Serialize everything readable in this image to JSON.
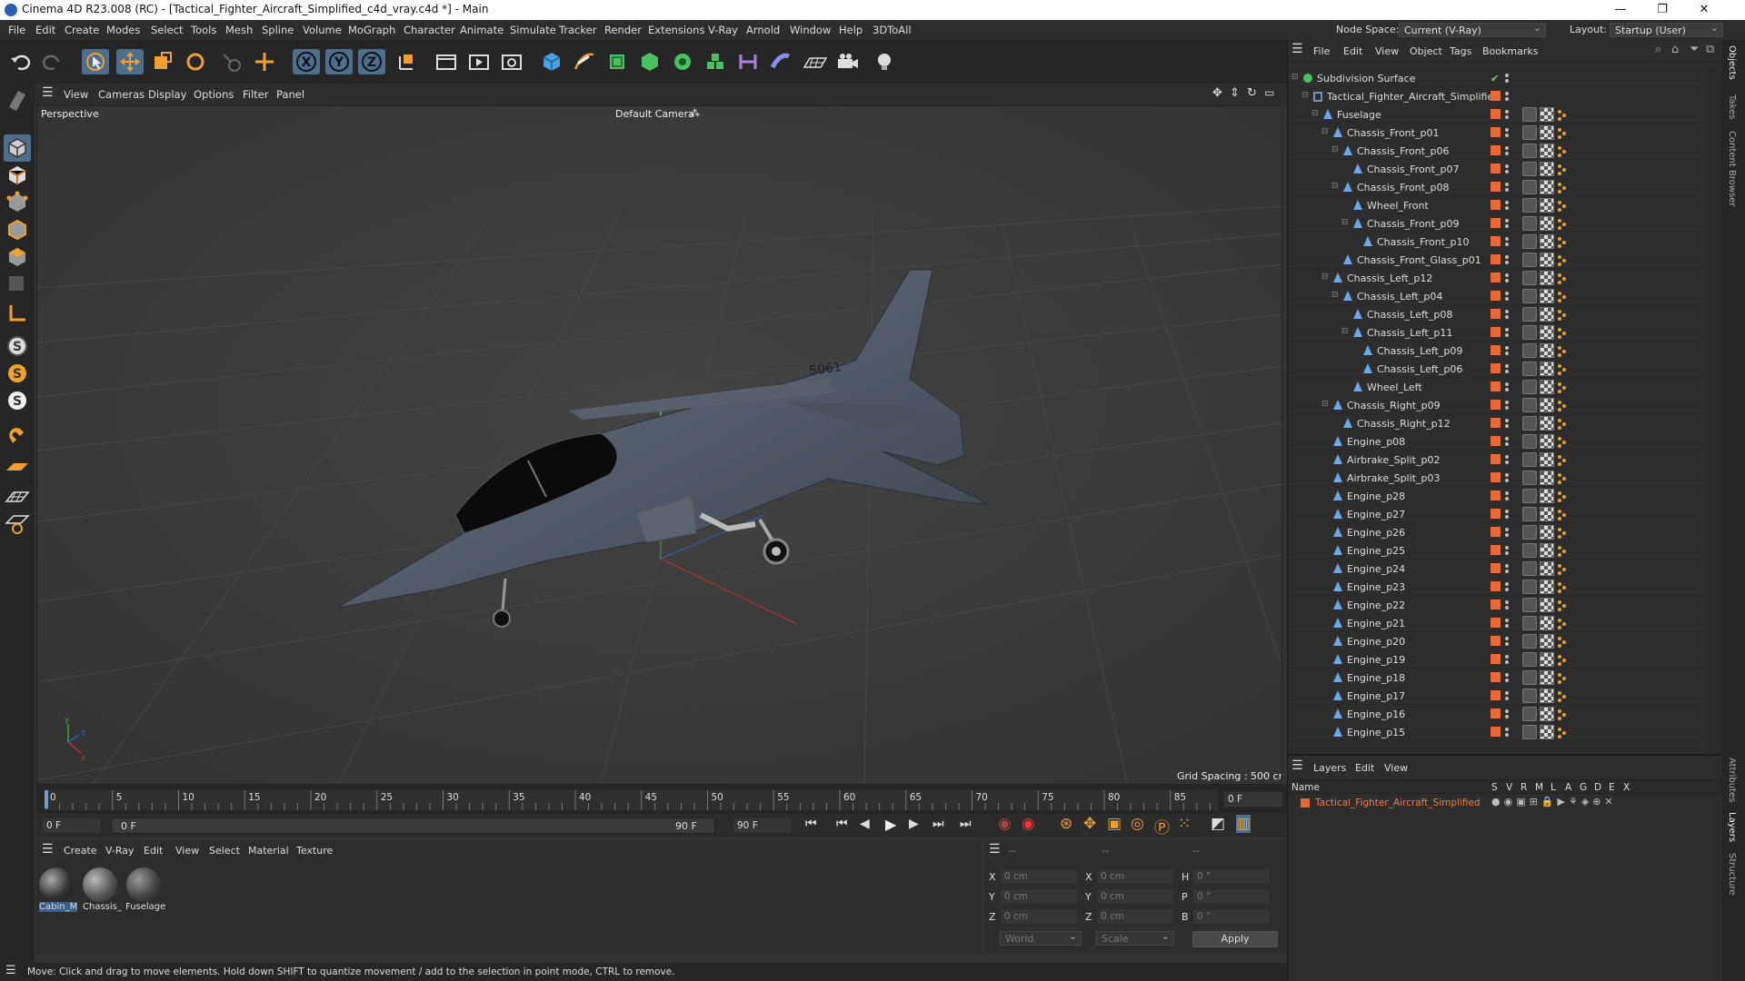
{
  "window": {
    "title": "Cinema 4D R23.008 (RC) - [Tactical_Fighter_Aircraft_Simplified_c4d_vray.c4d *] - Main",
    "minimize": "—",
    "maximize": "❐",
    "close": "✕"
  },
  "menu": [
    "File",
    "Edit",
    "Create",
    "Modes",
    "Select",
    "Tools",
    "Mesh",
    "Spline",
    "Volume",
    "MoGraph",
    "Character",
    "Animate",
    "Simulate",
    "Tracker",
    "Render",
    "Extensions",
    "V-Ray",
    "Arnold",
    "Window",
    "Help",
    "3DToAll"
  ],
  "node_space": {
    "label": "Node Space:",
    "value": "Current (V-Ray)"
  },
  "layout": {
    "label": "Layout:",
    "value": "Startup (User)"
  },
  "viewport": {
    "menu": [
      "View",
      "Cameras",
      "Display",
      "Options",
      "Filter",
      "Panel"
    ],
    "name": "Perspective",
    "camera": "Default Camera",
    "camera_glyph": "⁂",
    "grid_spacing": "Grid Spacing : 500 cm",
    "aircraft_text": "5061"
  },
  "timeline": {
    "ticks": [
      "0",
      "5",
      "10",
      "15",
      "20",
      "25",
      "30",
      "35",
      "40",
      "45",
      "50",
      "55",
      "60",
      "65",
      "70",
      "75",
      "80",
      "85",
      "90"
    ],
    "current_frame": "0 F",
    "start_field": "0 F",
    "range_start": "0 F",
    "range_end": "90 F",
    "end_field": "90 F"
  },
  "material_panel": {
    "menu": [
      "Create",
      "V-Ray",
      "Edit",
      "View",
      "Select",
      "Material",
      "Texture"
    ],
    "materials": [
      "Cabin_M",
      "Chassis_",
      "Fuselage"
    ]
  },
  "attributes": {
    "headers": [
      "--",
      "--",
      "--"
    ],
    "rows": [
      {
        "a": "X",
        "av": "0 cm",
        "b": "X",
        "bv": "0 cm",
        "c": "H",
        "cv": "0 °"
      },
      {
        "a": "Y",
        "av": "0 cm",
        "b": "Y",
        "bv": "0 cm",
        "c": "P",
        "cv": "0 °"
      },
      {
        "a": "Z",
        "av": "0 cm",
        "b": "Z",
        "bv": "0 cm",
        "c": "B",
        "cv": "0 °"
      }
    ],
    "coord_system": "World",
    "mode": "Scale",
    "apply": "Apply"
  },
  "status": "Move: Click and drag to move elements. Hold down SHIFT to quantize movement / add to the selection in point mode, CTRL to remove.",
  "objects_panel": {
    "menu": [
      "File",
      "Edit",
      "View",
      "Object",
      "Tags",
      "Bookmarks"
    ],
    "items": [
      {
        "name": "Subdivision Surface",
        "depth": 0,
        "type": "subdiv"
      },
      {
        "name": "Tactical_Fighter_Aircraft_Simplified",
        "depth": 1,
        "type": "null"
      },
      {
        "name": "Fuselage",
        "depth": 2,
        "type": "poly"
      },
      {
        "name": "Chassis_Front_p01",
        "depth": 3,
        "type": "poly"
      },
      {
        "name": "Chassis_Front_p06",
        "depth": 4,
        "type": "poly"
      },
      {
        "name": "Chassis_Front_p07",
        "depth": 5,
        "type": "poly"
      },
      {
        "name": "Chassis_Front_p08",
        "depth": 4,
        "type": "poly"
      },
      {
        "name": "Wheel_Front",
        "depth": 5,
        "type": "poly"
      },
      {
        "name": "Chassis_Front_p09",
        "depth": 5,
        "type": "poly"
      },
      {
        "name": "Chassis_Front_p10",
        "depth": 6,
        "type": "poly"
      },
      {
        "name": "Chassis_Front_Glass_p01",
        "depth": 4,
        "type": "poly"
      },
      {
        "name": "Chassis_Left_p12",
        "depth": 3,
        "type": "poly"
      },
      {
        "name": "Chassis_Left_p04",
        "depth": 4,
        "type": "poly"
      },
      {
        "name": "Chassis_Left_p08",
        "depth": 5,
        "type": "poly"
      },
      {
        "name": "Chassis_Left_p11",
        "depth": 5,
        "type": "poly"
      },
      {
        "name": "Chassis_Left_p09",
        "depth": 6,
        "type": "poly"
      },
      {
        "name": "Chassis_Left_p06",
        "depth": 6,
        "type": "poly"
      },
      {
        "name": "Wheel_Left",
        "depth": 5,
        "type": "poly"
      },
      {
        "name": "Chassis_Right_p09",
        "depth": 3,
        "type": "poly"
      },
      {
        "name": "Chassis_Right_p12",
        "depth": 4,
        "type": "poly"
      },
      {
        "name": "Engine_p08",
        "depth": 3,
        "type": "poly"
      },
      {
        "name": "Airbrake_Split_p02",
        "depth": 3,
        "type": "poly"
      },
      {
        "name": "Airbrake_Split_p03",
        "depth": 3,
        "type": "poly"
      },
      {
        "name": "Engine_p28",
        "depth": 3,
        "type": "poly"
      },
      {
        "name": "Engine_p27",
        "depth": 3,
        "type": "poly"
      },
      {
        "name": "Engine_p26",
        "depth": 3,
        "type": "poly"
      },
      {
        "name": "Engine_p25",
        "depth": 3,
        "type": "poly"
      },
      {
        "name": "Engine_p24",
        "depth": 3,
        "type": "poly"
      },
      {
        "name": "Engine_p23",
        "depth": 3,
        "type": "poly"
      },
      {
        "name": "Engine_p22",
        "depth": 3,
        "type": "poly"
      },
      {
        "name": "Engine_p21",
        "depth": 3,
        "type": "poly"
      },
      {
        "name": "Engine_p20",
        "depth": 3,
        "type": "poly"
      },
      {
        "name": "Engine_p19",
        "depth": 3,
        "type": "poly"
      },
      {
        "name": "Engine_p18",
        "depth": 3,
        "type": "poly"
      },
      {
        "name": "Engine_p17",
        "depth": 3,
        "type": "poly"
      },
      {
        "name": "Engine_p16",
        "depth": 3,
        "type": "poly"
      },
      {
        "name": "Engine_p15",
        "depth": 3,
        "type": "poly"
      }
    ]
  },
  "layers_panel": {
    "menu": [
      "Layers",
      "Edit",
      "View"
    ],
    "name_header": "Name",
    "columns": [
      "S",
      "V",
      "R",
      "M",
      "L",
      "A",
      "G",
      "D",
      "E",
      "X"
    ],
    "layer": {
      "name": "Tactical_Fighter_Aircraft_Simplified",
      "color": "#e66a3a"
    }
  },
  "side_tabs": [
    "Objects",
    "Takes",
    "Content Browser",
    "Attributes",
    "Layers",
    "Structure"
  ],
  "colors": {
    "accent": "#4d6e8c",
    "layer_text": "#e8804a",
    "x_axis": "#c03030",
    "y_axis": "#40a040",
    "z_axis": "#3060c0"
  }
}
